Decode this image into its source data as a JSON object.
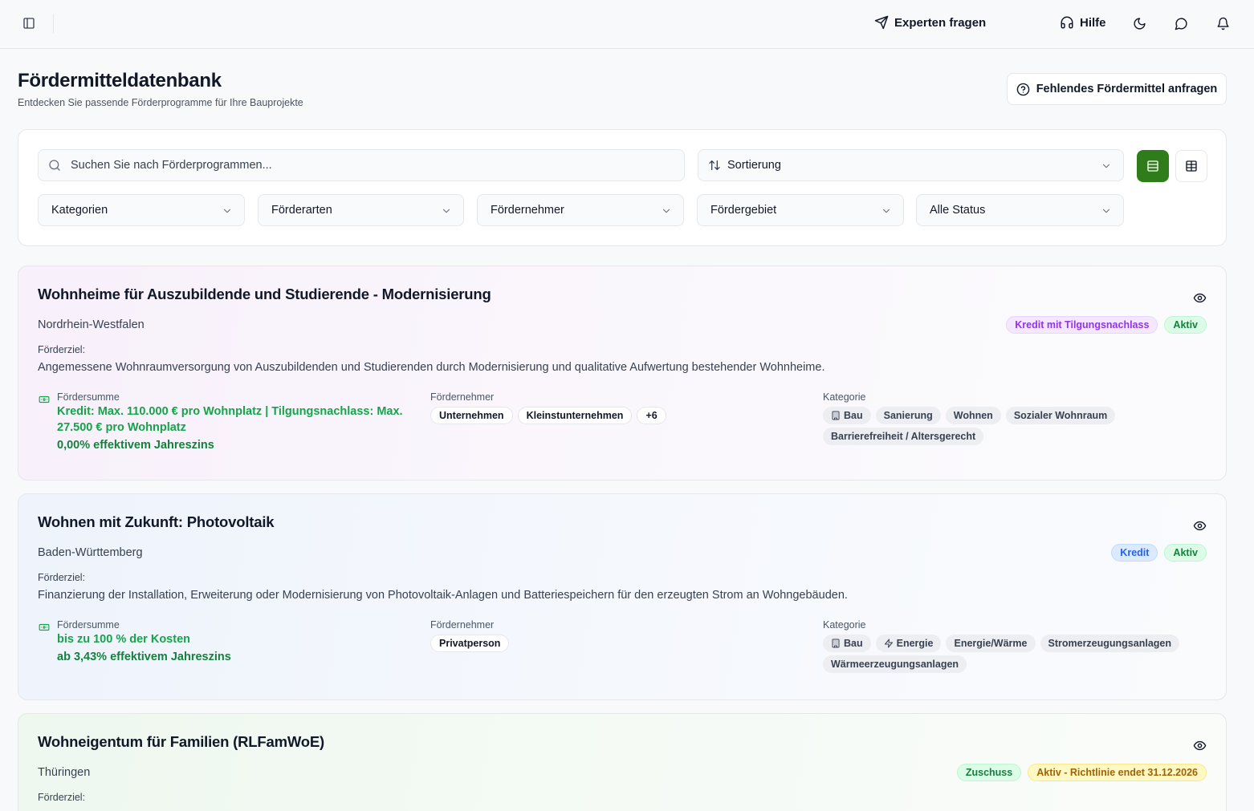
{
  "topbar": {
    "experts_label": "Experten fragen",
    "help_label": "Hilfe"
  },
  "header": {
    "title": "Fördermitteldatenbank",
    "subtitle": "Entdecken Sie passende Förderprogramme für Ihre Bauprojekte",
    "request_button": "Fehlendes Fördermittel anfragen"
  },
  "filters": {
    "search_placeholder": "Suchen Sie nach Förderprogrammen...",
    "sort_label": "Sortierung",
    "categories": "Kategorien",
    "funding_types": "Förderarten",
    "recipients": "Fördernehmer",
    "region": "Fördergebiet",
    "status": "Alle Status"
  },
  "labels": {
    "goal": "Förderziel:",
    "amount": "Fördersumme",
    "recipient": "Fördernehmer",
    "category": "Kategorie"
  },
  "programs": [
    {
      "title": "Wohnheime für Auszubildende und Studierende - Modernisierung",
      "region": "Nordrhein-Westfalen",
      "badges": [
        "Kredit mit Tilgungsnachlass",
        "Aktiv"
      ],
      "goal": "Angemessene Wohnraumversorgung von Auszubildenden und Studierenden durch Modernisierung und qualitative Aufwertung bestehender Wohnheime.",
      "amount": "Kredit: Max. 110.000 € pro Wohnplatz | Tilgungsnachlass: Max. 27.500 € pro Wohnplatz",
      "rate": "0,00% effektivem Jahreszins",
      "recipients": [
        "Unternehmen",
        "Kleinstunternehmen",
        "+6"
      ],
      "categories": [
        "Bau",
        "Sanierung",
        "Wohnen",
        "Sozialer Wohnraum",
        "Barrierefreiheit / Altersgerecht"
      ]
    },
    {
      "title": "Wohnen mit Zukunft: Photovoltaik",
      "region": "Baden-Württemberg",
      "badges": [
        "Kredit",
        "Aktiv"
      ],
      "goal": "Finanzierung der Installation, Erweiterung oder Modernisierung von Photovoltaik-Anlagen und Batteriespeichern für den erzeugten Strom an Wohngebäuden.",
      "amount": "bis zu 100 % der Kosten",
      "rate": "ab 3,43% effektivem Jahreszins",
      "recipients": [
        "Privatperson"
      ],
      "categories": [
        "Bau",
        "Energie",
        "Energie/Wärme",
        "Stromerzeugungsanlagen",
        "Wärmeerzeugungsanlagen"
      ]
    },
    {
      "title": "Wohneigentum für Familien (RLFamWoE)",
      "region": "Thüringen",
      "badges": [
        "Zuschuss",
        "Aktiv - Richtlinie endet 31.12.2026"
      ]
    }
  ],
  "colors": {
    "primary_green": "#2f7d1a",
    "amount_green": "#16a34a",
    "purple_badge": "#9333ea",
    "blue_badge": "#2563eb",
    "yellow_badge": "#a16207"
  }
}
